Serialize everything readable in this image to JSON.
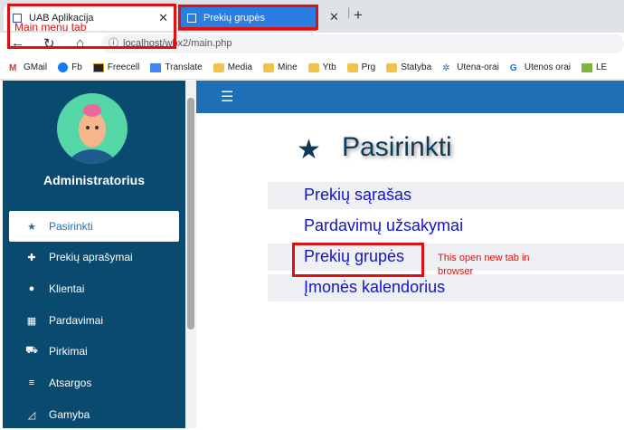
{
  "tabs": [
    {
      "label": "UAB Aplikacija",
      "close": "✕"
    },
    {
      "label": "Prekių grupės",
      "close": "✕"
    }
  ],
  "new_tab": "+",
  "address": {
    "url": "localhost/wbx2/main.php"
  },
  "bookmarks": [
    "GMail",
    "Fb",
    "Freecell",
    "Translate",
    "Media",
    "Mine",
    "Ytb",
    "Prg",
    "Statyba",
    "Utena-orai",
    "Utenos orai",
    "LE"
  ],
  "sidebar": {
    "user_name": "Administratorius",
    "items": [
      {
        "label": "Pasirinkti",
        "icon": "star-icon"
      },
      {
        "label": "Prekių aprašymai",
        "icon": "puzzle-icon"
      },
      {
        "label": "Klientai",
        "icon": "user-circle-icon"
      },
      {
        "label": "Pardavimai",
        "icon": "calculator-icon"
      },
      {
        "label": "Pirkimai",
        "icon": "cart-icon"
      },
      {
        "label": "Atsargos",
        "icon": "list-icon"
      },
      {
        "label": "Gamyba",
        "icon": "triangle-ruler-icon"
      }
    ]
  },
  "main": {
    "title": "Pasirinkti",
    "links": [
      "Prekių sąrašas",
      "Pardavimų užsakymai",
      "Prekių grupės",
      "Įmonės kalendorius"
    ]
  },
  "annotations": {
    "tab_note": "Main menu tab",
    "link_note_1": "This open new tab in",
    "link_note_2": "browser"
  }
}
